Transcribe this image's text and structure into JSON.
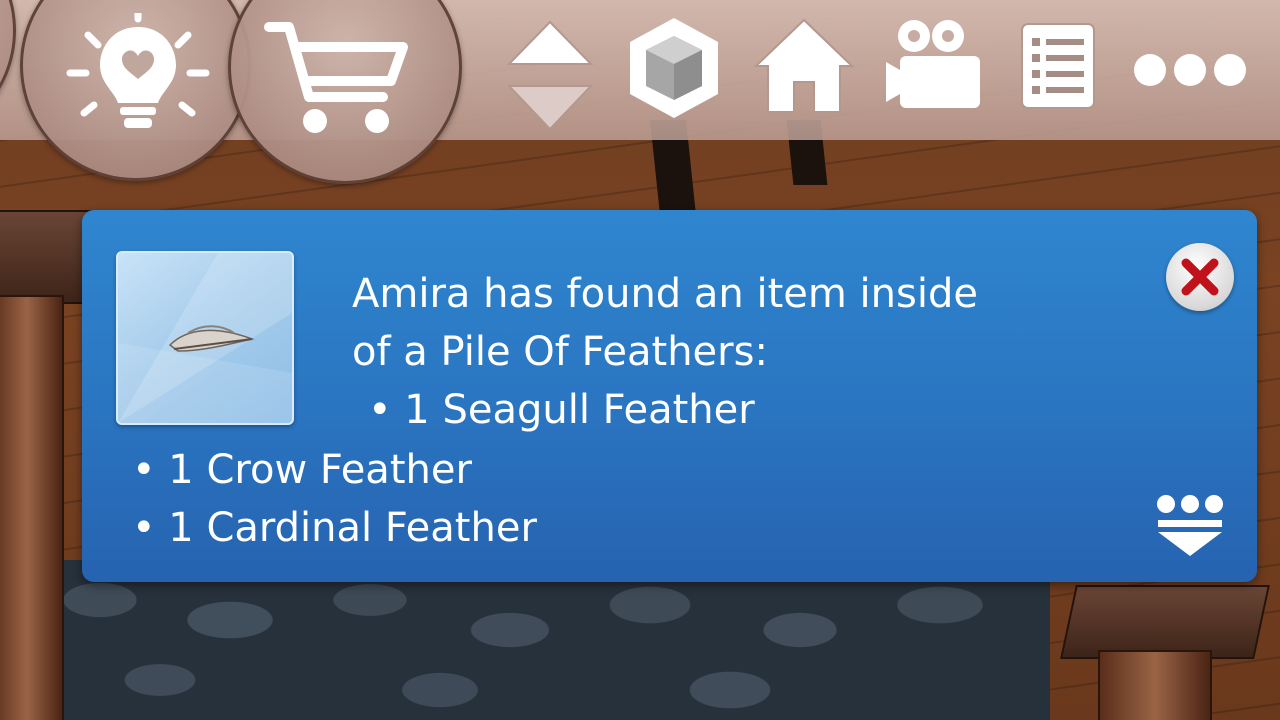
{
  "toolbar": {
    "buttons": [
      {
        "name": "lightbulb-heart-icon"
      },
      {
        "name": "shopping-cart-icon"
      },
      {
        "name": "level-up-down-icon"
      },
      {
        "name": "cube-view-icon"
      },
      {
        "name": "house-icon"
      },
      {
        "name": "camera-icon"
      },
      {
        "name": "list-icon"
      },
      {
        "name": "more-options-icon"
      }
    ]
  },
  "notification": {
    "line1": "Amira has found an item inside",
    "line2": "of a Pile Of Feathers:",
    "line3": "• 1 Seagull Feather",
    "line4": "• 1 Crow Feather",
    "line5": "• 1 Cardinal Feather",
    "thumbnail_icon": "feather-icon",
    "close_icon": "close-icon",
    "expand_icon": "expand-more-icon"
  },
  "colors": {
    "notification_bg": "#2a74c0",
    "close_x": "#c0121a",
    "toolbar_band": "#c8a89c"
  }
}
